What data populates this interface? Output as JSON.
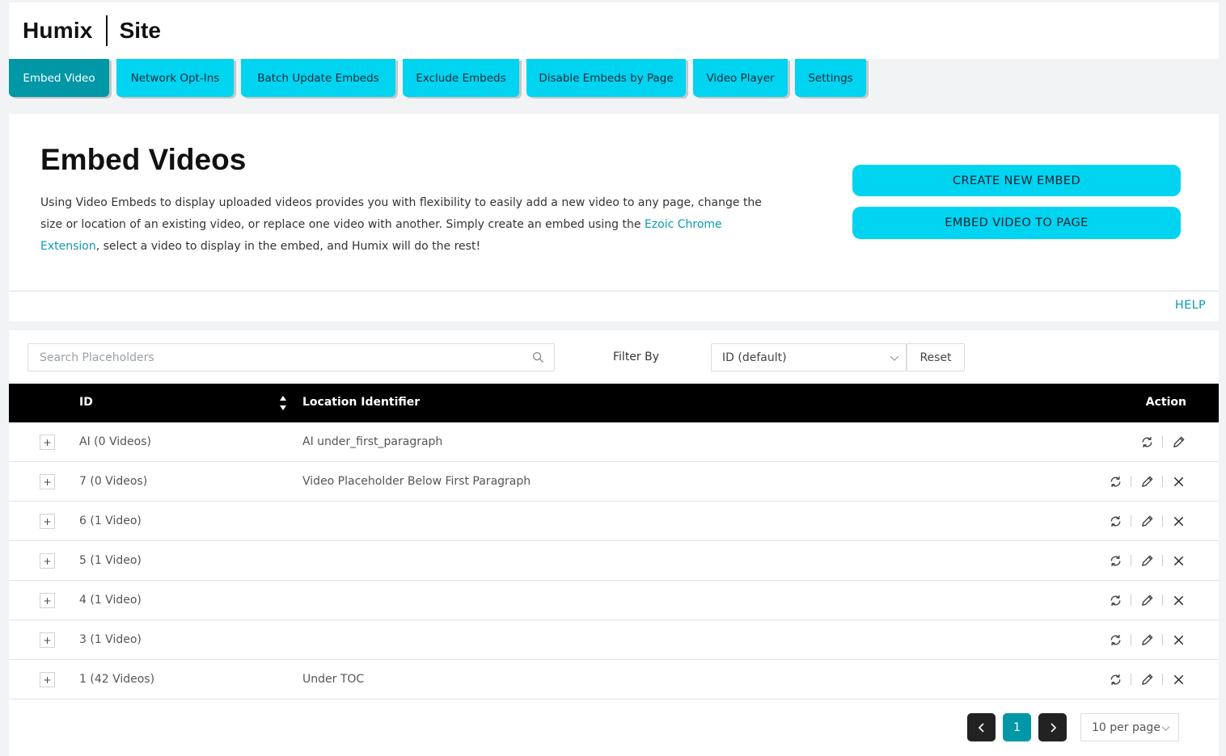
{
  "brand": {
    "name": "Humix",
    "section": "Site"
  },
  "tabs": [
    {
      "label": "Embed Video",
      "active": true
    },
    {
      "label": "Network Opt-Ins",
      "active": false
    },
    {
      "label": "Batch Update Embeds",
      "active": false
    },
    {
      "label": "Exclude Embeds",
      "active": false
    },
    {
      "label": "Disable Embeds by Page",
      "active": false
    },
    {
      "label": "Video Player",
      "active": false
    },
    {
      "label": "Settings",
      "active": false
    }
  ],
  "intro": {
    "title": "Embed Videos",
    "text_before_link": "Using Video Embeds to display uploaded videos provides you with flexibility to easily add a new video to any page, change the size or location of an existing video, or replace one video with another. Simply create an embed using the ",
    "link_text": "Ezoic Chrome Extension",
    "text_after_link": ", select a video to display in the embed, and Humix will do the rest!",
    "create_button": "CREATE NEW EMBED",
    "embed_button": "EMBED VIDEO TO PAGE",
    "help": "HELP"
  },
  "toolbar": {
    "search_placeholder": "Search Placeholders",
    "filter_label": "Filter By",
    "filter_value": "ID (default)",
    "reset": "Reset"
  },
  "table": {
    "headers": {
      "id": "ID",
      "location": "Location Identifier",
      "action": "Action"
    },
    "rows": [
      {
        "expand": "+",
        "id": "AI (0 Videos)",
        "location": "AI under_first_paragraph",
        "deletable": false
      },
      {
        "expand": "+",
        "id": "7 (0 Videos)",
        "location": "Video Placeholder Below First Paragraph",
        "deletable": true
      },
      {
        "expand": "+",
        "id": "6 (1 Video)",
        "location": "",
        "deletable": true
      },
      {
        "expand": "+",
        "id": "5 (1 Video)",
        "location": "",
        "deletable": true
      },
      {
        "expand": "+",
        "id": "4 (1 Video)",
        "location": "",
        "deletable": true
      },
      {
        "expand": "+",
        "id": "3 (1 Video)",
        "location": "",
        "deletable": true
      },
      {
        "expand": "+",
        "id": "1 (42 Videos)",
        "location": "Under TOC",
        "deletable": true
      }
    ]
  },
  "pagination": {
    "current_page": "1",
    "per_page": "10 per page"
  },
  "icons": {
    "search": "search-icon",
    "sort": "sort-icon",
    "sync": "sync-icon",
    "edit": "pencil-icon",
    "delete": "close-icon",
    "prev": "chevron-left-icon",
    "next": "chevron-right-icon"
  },
  "colors": {
    "accent": "#00d4f0",
    "accent_dark": "#0097a7",
    "link": "#0a9bb0",
    "header_bg": "#000000"
  }
}
